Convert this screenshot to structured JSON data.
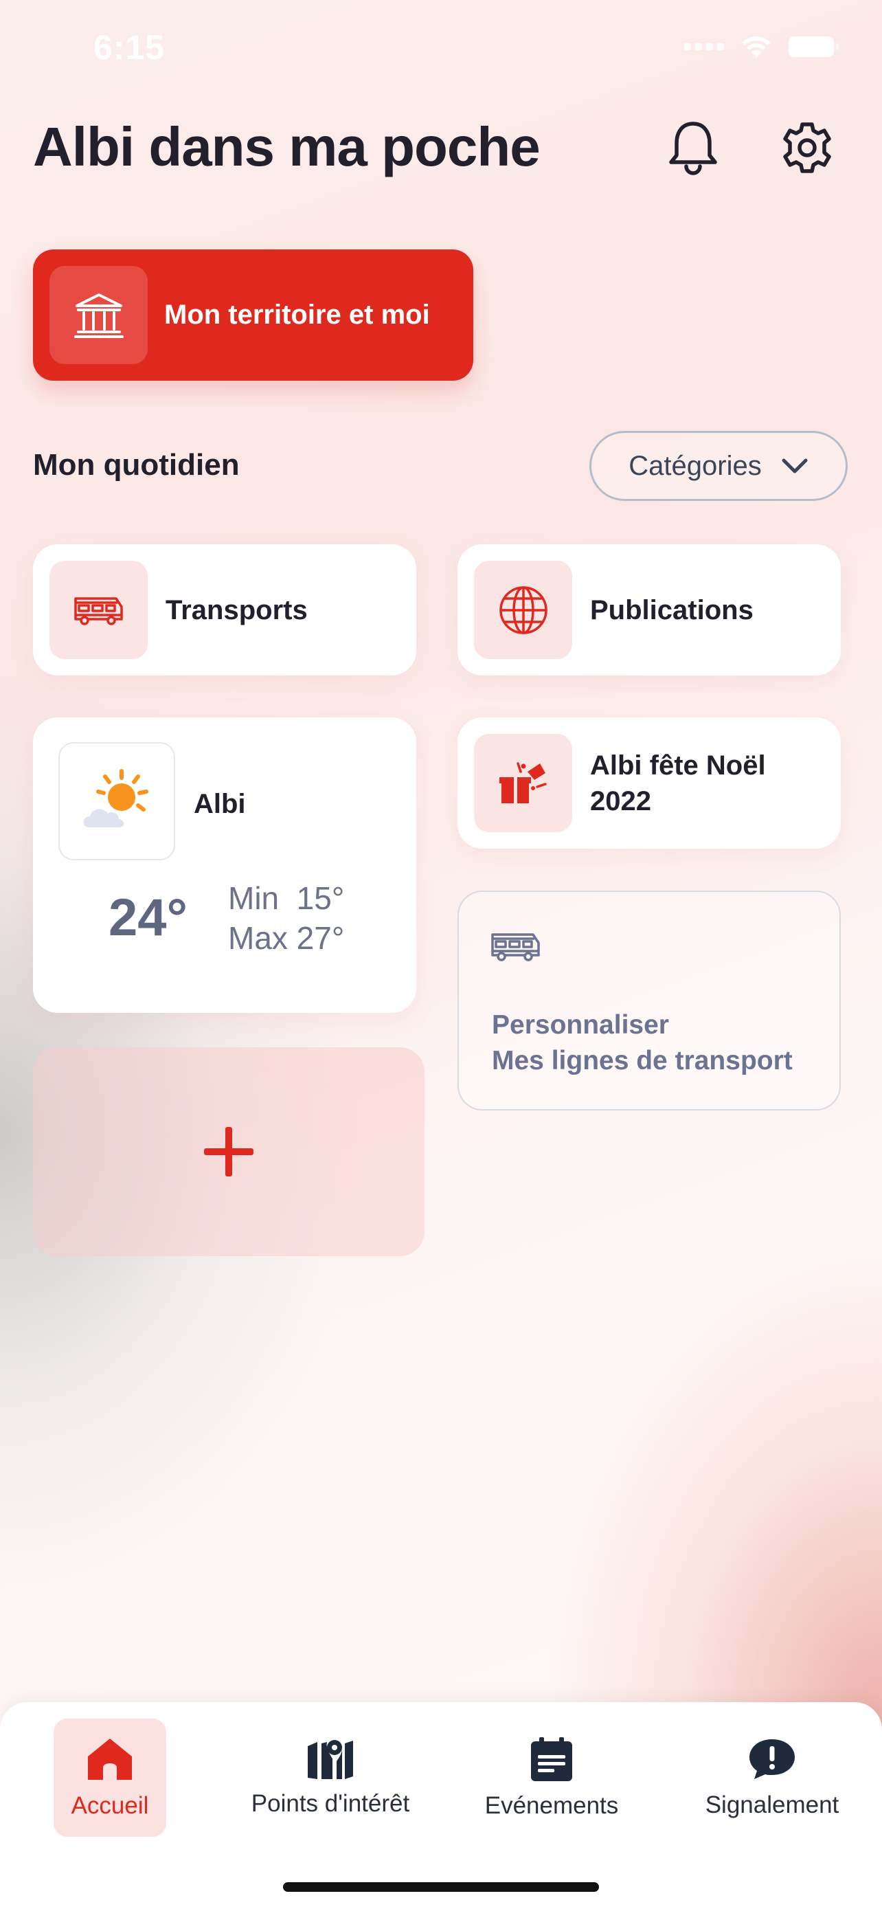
{
  "status_bar": {
    "time": "6:15"
  },
  "header": {
    "title": "Albi dans ma poche"
  },
  "hero": {
    "label": "Mon territoire et moi"
  },
  "daily": {
    "title": "Mon quotidien",
    "categories_label": "Catégories"
  },
  "tiles": {
    "transports": "Transports",
    "publications": "Publications",
    "noel_line1": "Albi fête Noël",
    "noel_line2": "2022"
  },
  "weather": {
    "city": "Albi",
    "temperature": "24°",
    "min": "Min  15°",
    "max": "Max 27°"
  },
  "customize": {
    "line1": "Personnaliser",
    "line2": "Mes lignes de transport"
  },
  "nav": {
    "items": [
      {
        "label": "Accueil",
        "icon": "home-icon",
        "active": true
      },
      {
        "label": "Points d'intérêt",
        "icon": "map-icon",
        "active": false
      },
      {
        "label": "Evénements",
        "icon": "calendar-icon",
        "active": false
      },
      {
        "label": "Signalement",
        "icon": "alert-bubble-icon",
        "active": false
      }
    ]
  },
  "colors": {
    "brand_red": "#e0291e",
    "tile_icon_bg": "#fbe5e4",
    "text_dark": "#22202c",
    "text_muted": "#6b7391",
    "sun_orange": "#f7941d"
  }
}
